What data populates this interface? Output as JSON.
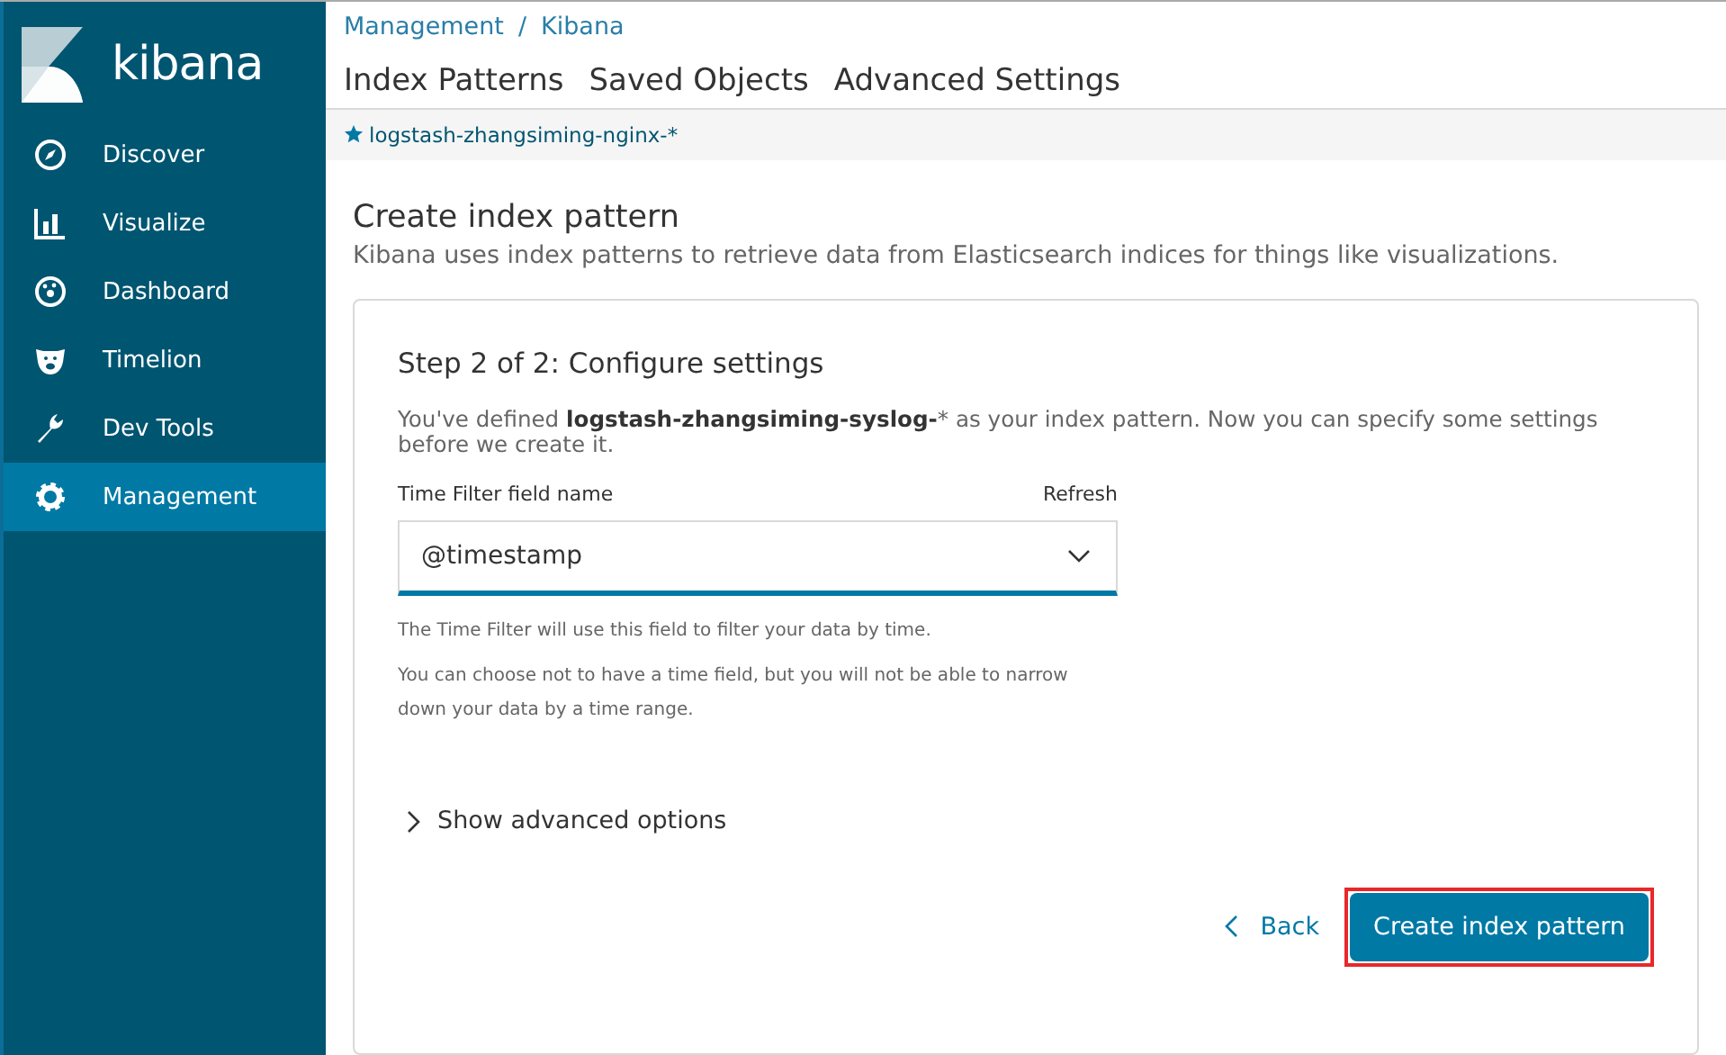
{
  "sidebar": {
    "logo_text": "kibana",
    "items": [
      {
        "label": "Discover",
        "selected": false
      },
      {
        "label": "Visualize",
        "selected": false
      },
      {
        "label": "Dashboard",
        "selected": false
      },
      {
        "label": "Timelion",
        "selected": false
      },
      {
        "label": "Dev Tools",
        "selected": false
      },
      {
        "label": "Management",
        "selected": true
      }
    ]
  },
  "breadcrumbs": [
    "Management",
    "Kibana"
  ],
  "breadcrumb_separator": "/",
  "tabs": [
    "Index Patterns",
    "Saved Objects",
    "Advanced Settings"
  ],
  "index_pattern_link": "logstash-zhangsiming-nginx-*",
  "page": {
    "title": "Create index pattern",
    "subtitle": "Kibana uses index patterns to retrieve data from Elasticsearch indices for things like visualizations."
  },
  "step": {
    "title": "Step 2 of 2: Configure settings",
    "description": "You've defined **logstash-zhangsiming-syslog-*** as your index pattern. Now you can specify some settings before we create it.",
    "field_label": "Time Filter field name",
    "refresh": "Refresh",
    "field_value": "@timestamp",
    "help": [
      "The Time Filter will use this field to filter your data by time.",
      "You can choose not to have a time field, but you will not be able to narrow down your data by a time range."
    ],
    "advanced": "Show advanced options",
    "back": "Back",
    "create": "Create index pattern"
  }
}
